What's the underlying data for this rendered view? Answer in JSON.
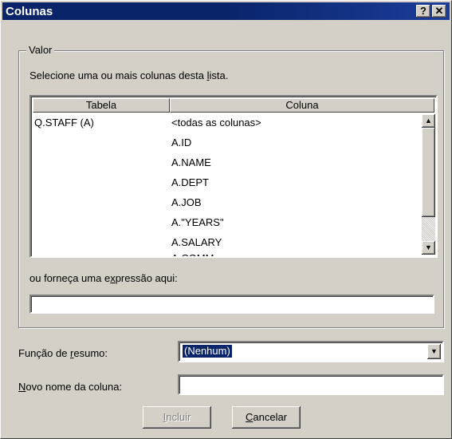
{
  "window": {
    "title": "Colunas",
    "help_button": "?",
    "close_button": "✕"
  },
  "group": {
    "label": "Valor",
    "instruction_pre": "Selecione uma ou mais colunas desta ",
    "instruction_key": "l",
    "instruction_post": "ista."
  },
  "list": {
    "columns": [
      "Tabela",
      "Coluna"
    ],
    "rows": [
      {
        "tabela": "Q.STAFF (A)",
        "coluna": "<todas as colunas>"
      },
      {
        "tabela": "",
        "coluna": "A.ID"
      },
      {
        "tabela": "",
        "coluna": "A.NAME"
      },
      {
        "tabela": "",
        "coluna": "A.DEPT"
      },
      {
        "tabela": "",
        "coluna": "A.JOB"
      },
      {
        "tabela": "",
        "coluna": "A.\"YEARS\""
      },
      {
        "tabela": "",
        "coluna": "A.SALARY"
      },
      {
        "tabela": "",
        "coluna": "A.COMM"
      }
    ]
  },
  "expression": {
    "label_pre": "ou forneça uma e",
    "label_key": "x",
    "label_post": "pressão aqui:",
    "value": ""
  },
  "summary": {
    "label_pre": "Função de ",
    "label_key": "r",
    "label_post": "esumo:",
    "selected": "(Nenhum)"
  },
  "new_name": {
    "label_key": "N",
    "label_post": "ovo nome da coluna:",
    "value": ""
  },
  "buttons": {
    "include_key": "I",
    "include_post": "ncluir",
    "cancel_key": "C",
    "cancel_post": "ancelar"
  }
}
